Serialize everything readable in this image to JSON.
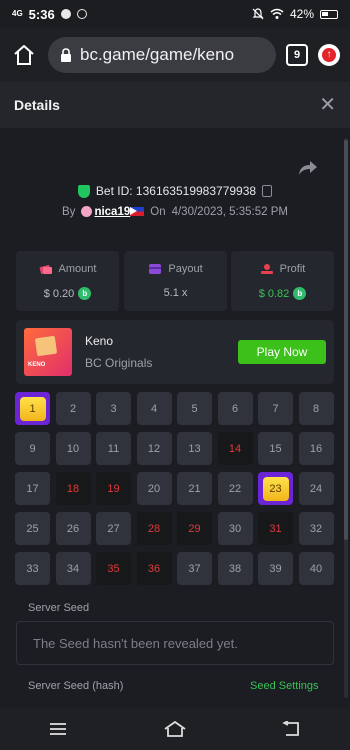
{
  "status_bar": {
    "time": "5:36",
    "network": "4G",
    "battery": "42%",
    "icons": [
      "messenger-icon",
      "sync-icon",
      "mute-icon",
      "wifi-icon"
    ]
  },
  "browser": {
    "url": "bc.game/game/keno",
    "tab_count": "9",
    "icons": [
      "home-icon",
      "lock-icon",
      "tabs-icon",
      "update-icon"
    ]
  },
  "details": {
    "title": "Details",
    "close_label": "✕"
  },
  "bet": {
    "id": "Bet ID: 136163519983779938",
    "by_label": "By",
    "username": "nica19",
    "on_label": "On",
    "date": "4/30/2023, 5:35:52 PM"
  },
  "stats": {
    "amount_label": "Amount",
    "amount_value": "$ 0.20",
    "payout_label": "Payout",
    "payout_value": "5.1 x",
    "profit_label": "Profit",
    "profit_value": "$ 0.82",
    "coin_symbol": "b"
  },
  "game": {
    "name": "Keno",
    "provider": "BC Originals",
    "play_label": "Play Now",
    "thumb_text": "KENO"
  },
  "grid": {
    "numbers": [
      1,
      2,
      3,
      4,
      5,
      6,
      7,
      8,
      9,
      10,
      11,
      12,
      13,
      14,
      15,
      16,
      17,
      18,
      19,
      20,
      21,
      22,
      23,
      24,
      25,
      26,
      27,
      28,
      29,
      30,
      31,
      32,
      33,
      34,
      35,
      36,
      37,
      38,
      39,
      40
    ],
    "picked_matches": [
      1,
      23
    ],
    "drawn_numbers": [
      14,
      18,
      19,
      28,
      29,
      31,
      35,
      36
    ],
    "colors": {
      "hit_text": "#e03a3a",
      "pick_bg": "#6b25d6",
      "gem": "#ffd22e"
    }
  },
  "seeds": {
    "server_seed_label": "Server Seed",
    "server_seed_value": "The Seed hasn't been revealed yet.",
    "server_seed_hash_label": "Server Seed (hash)",
    "seed_settings_label": "Seed Settings"
  },
  "nav": {
    "icons": [
      "menu-icon",
      "home-icon",
      "back-icon"
    ]
  }
}
